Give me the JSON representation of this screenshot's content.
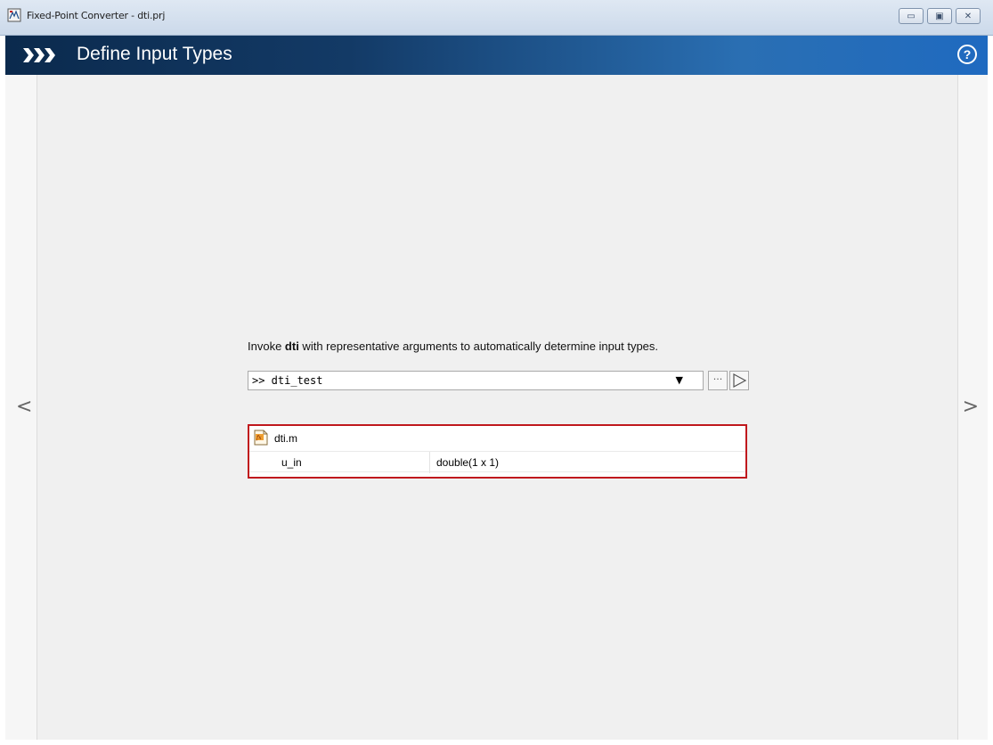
{
  "window": {
    "title": "Fixed-Point Converter - dti.prj",
    "minimize_glyph": "▭",
    "maximize_glyph": "▣",
    "close_glyph": "✕"
  },
  "header": {
    "title": "Define Input Types",
    "help_glyph": "?",
    "accent_dark": "#0b2a4d",
    "accent_light": "#2a6fb3"
  },
  "nav": {
    "prev_glyph": "<",
    "next_glyph": ">"
  },
  "instruction": {
    "prefix": "Invoke ",
    "function_name": "dti",
    "suffix": " with representative arguments to automatically determine input types."
  },
  "command": {
    "value": ">> dti_test",
    "dropdown_glyph": "▼",
    "browse_glyph": "···"
  },
  "function_panel": {
    "file_name": "dti.m",
    "highlight_color": "#c0181d",
    "arguments": [
      {
        "name": "u_in",
        "type": "double(1 x 1)"
      }
    ]
  }
}
